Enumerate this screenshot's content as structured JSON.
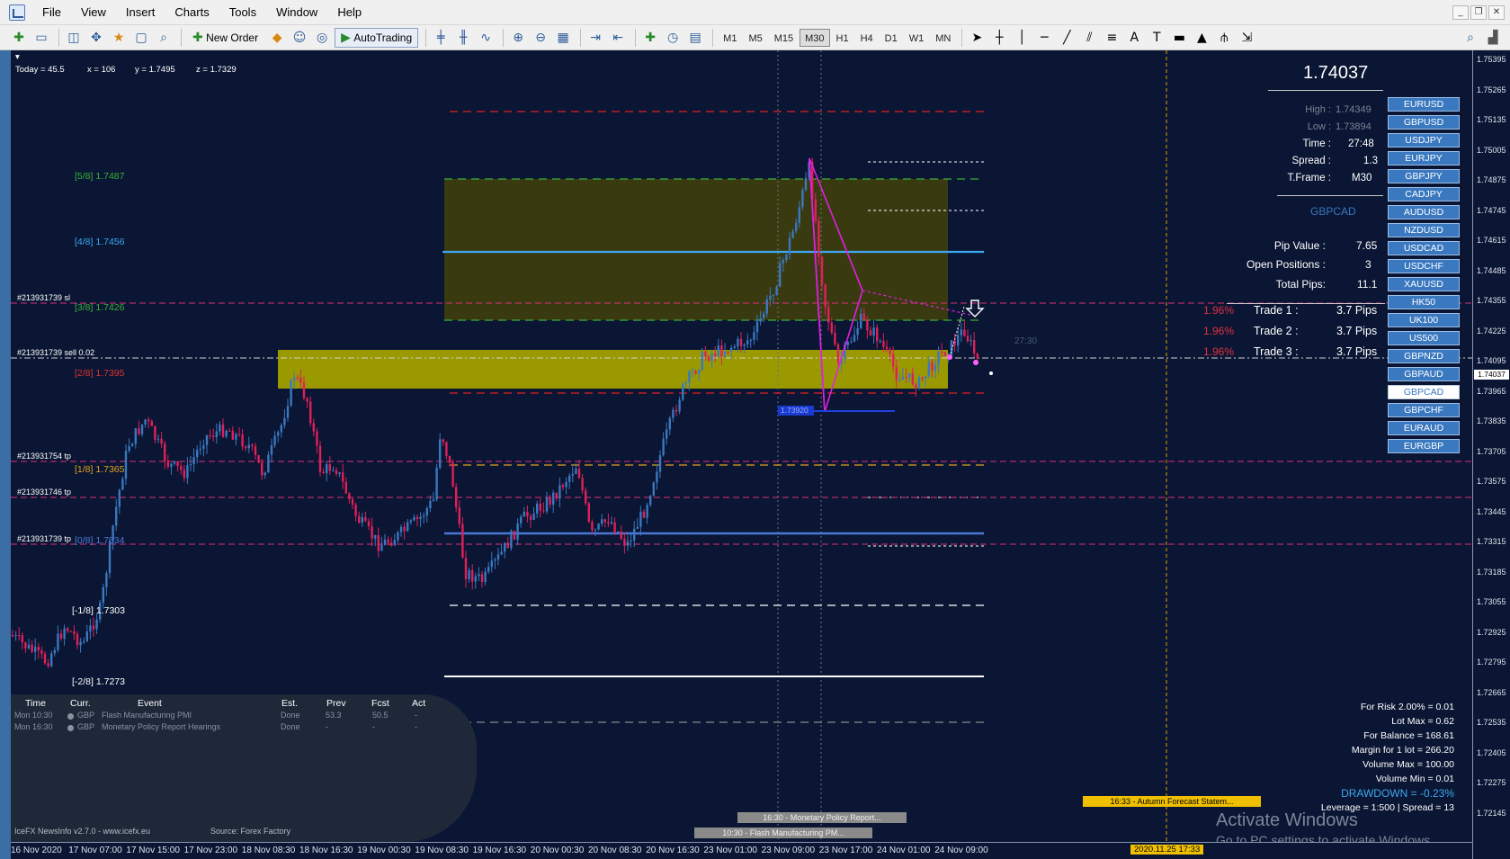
{
  "menu": [
    "File",
    "View",
    "Insert",
    "Charts",
    "Tools",
    "Window",
    "Help"
  ],
  "toolbar": {
    "new_order": "New Order",
    "autotrading": "AutoTrading",
    "timeframes": [
      "M1",
      "M5",
      "M15",
      "M30",
      "H1",
      "H4",
      "D1",
      "W1",
      "MN"
    ],
    "active_timeframe": "M30"
  },
  "status_line": {
    "today": "Today = 45.5",
    "x": "x = 106",
    "y": "y = 1.7495",
    "z": "z = 1.7329"
  },
  "murrey_levels": [
    {
      "label": "[5/8]",
      "price": "1.7487",
      "color": "#3ab03a"
    },
    {
      "label": "[4/8]",
      "price": "1.7456",
      "color": "#3ea8f0"
    },
    {
      "label": "[3/8]",
      "price": "1.7426",
      "color": "#3ab03a"
    },
    {
      "label": "[2/8]",
      "price": "1.7395",
      "color": "#e03030"
    },
    {
      "label": "[1/8]",
      "price": "1.7365",
      "color": "#e0a020"
    },
    {
      "label": "[0/8]",
      "price": "1.7334",
      "color": "#4a78d8"
    },
    {
      "label": "[-1/8]",
      "price": "1.7303",
      "color": "#ffffff"
    },
    {
      "label": "[-2/8]",
      "price": "1.7273",
      "color": "#ffffff"
    }
  ],
  "order_labels": [
    {
      "text": "#213931739 sl"
    },
    {
      "text": "#213931739 sell 0.02"
    },
    {
      "text": "#213931754 tp"
    },
    {
      "text": "#213931746 tp"
    },
    {
      "text": "#213931739 tp"
    }
  ],
  "fib_label": "1.73920",
  "timer_text": "27:30",
  "info_panel": {
    "price": "1.74037",
    "high_label": "High :",
    "high": "1.74349",
    "low_label": "Low :",
    "low": "1.73894",
    "time_label": "Time :",
    "time": "27:48",
    "spread_label": "Spread :",
    "spread": "1.3",
    "tframe_label": "T.Frame :",
    "tframe": "M30",
    "symbol": "GBPCAD",
    "pip_value_label": "Pip Value :",
    "pip_value": "7.65",
    "open_positions_label": "Open Positions :",
    "open_positions": "3",
    "total_pips_label": "Total Pips:",
    "total_pips": "11.1",
    "trades": [
      {
        "pct": "1.96%",
        "label": "Trade 1 :",
        "pips": "3.7 Pips"
      },
      {
        "pct": "1.96%",
        "label": "Trade 2 :",
        "pips": "3.7 Pips"
      },
      {
        "pct": "1.96%",
        "label": "Trade 3 :",
        "pips": "3.7 Pips"
      }
    ]
  },
  "symbols": [
    "EURUSD",
    "GBPUSD",
    "USDJPY",
    "EURJPY",
    "GBPJPY",
    "CADJPY",
    "AUDUSD",
    "NZDUSD",
    "USDCAD",
    "USDCHF",
    "XAUUSD",
    "HK50",
    "UK100",
    "US500",
    "GBPNZD",
    "GBPAUD",
    "GBPCAD",
    "GBPCHF",
    "EURAUD",
    "EURGBP"
  ],
  "active_symbol": "GBPCAD",
  "price_ticks": [
    "1.75395",
    "1.75265",
    "1.75135",
    "1.75005",
    "1.74875",
    "1.74745",
    "1.74615",
    "1.74485",
    "1.74355",
    "1.74225",
    "1.74095",
    "1.73965",
    "1.73835",
    "1.73705",
    "1.73575",
    "1.73445",
    "1.73315",
    "1.73185",
    "1.73055",
    "1.72925",
    "1.72795",
    "1.72665",
    "1.72535",
    "1.72405",
    "1.72275",
    "1.72145"
  ],
  "current_price_tag": "1.74037",
  "time_ticks": [
    "16 Nov 2020",
    "17 Nov 07:00",
    "17 Nov 15:00",
    "17 Nov 23:00",
    "18 Nov 08:30",
    "18 Nov 16:30",
    "19 Nov 00:30",
    "19 Nov 08:30",
    "19 Nov 16:30",
    "20 Nov 00:30",
    "20 Nov 08:30",
    "20 Nov 16:30",
    "23 Nov 01:00",
    "23 Nov 09:00",
    "23 Nov 17:00",
    "24 Nov 01:00",
    "24 Nov 09:00"
  ],
  "time_tag": "2020.11.25 17:33",
  "news": {
    "headers": {
      "time": "Time",
      "curr": "Curr.",
      "event": "Event",
      "est": "Est.",
      "prev": "Prev",
      "fcst": "Fcst",
      "act": "Act"
    },
    "rows": [
      {
        "time": "Mon 10:30",
        "curr": "GBP",
        "event": "Flash Manufacturing PMI",
        "est": "Done",
        "prev": "53.3",
        "fcst": "50.5",
        "act": "-"
      },
      {
        "time": "Mon 16:30",
        "curr": "GBP",
        "event": "Monetary Policy Report Hearings",
        "est": "Done",
        "prev": "-",
        "fcst": "-",
        "act": "-"
      }
    ],
    "footer_left": "IceFX NewsInfo v2.7.0  -  www.icefx.eu",
    "footer_source": "Source: Forex Factory"
  },
  "news_strips": [
    "16:30 - Monetary Policy Report...",
    "10:30 - Flash Manufacturing PM..."
  ],
  "yellow_news": "16:33 - Autumn Forecast Statem...",
  "risk_panel": {
    "lines": [
      "For Risk 2.00% = 0.01",
      "Lot Max = 0.62",
      "For Balance = 168.61",
      "Margin for 1 lot = 266.20",
      "Volume Max = 100.00",
      "Volume Min = 0.01"
    ],
    "drawdown": "DRAWDOWN = -0.23%",
    "leverage": "Leverage = 1:500 | Spread = 13"
  },
  "activate_windows": {
    "title": "Activate Windows",
    "subtitle": "Go to PC settings to activate Windows."
  },
  "colors": {
    "background": "#0a1633",
    "bull_candle": "#3a78c0",
    "bear_candle": "#e0205a",
    "zone_yellow": "#9a9a00",
    "zone_olive": "#3a3a10"
  }
}
